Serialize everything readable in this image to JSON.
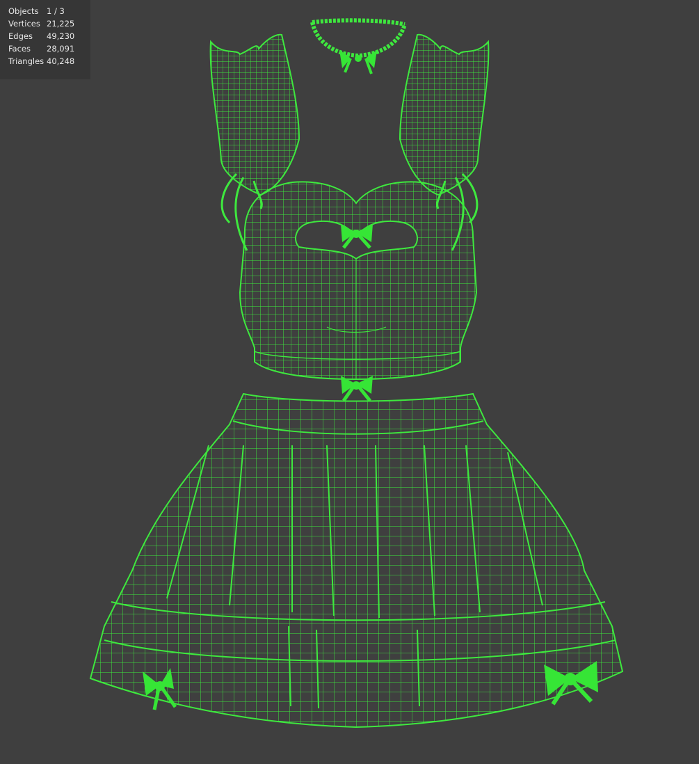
{
  "viewport": {
    "background_color": "#3f3f3f",
    "wire_color": "#3ee83e",
    "bow_color": "#36e536"
  },
  "stats": {
    "rows": [
      {
        "label": "Objects",
        "value": "1 / 3"
      },
      {
        "label": "Vertices",
        "value": "21,225"
      },
      {
        "label": "Edges",
        "value": "49,230"
      },
      {
        "label": "Faces",
        "value": "28,091"
      },
      {
        "label": "Triangles",
        "value": "40,248"
      }
    ]
  }
}
